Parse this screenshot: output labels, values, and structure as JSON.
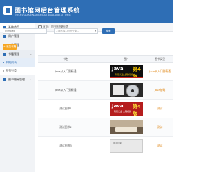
{
  "header": {
    "title": "图书馆网后台管理系统",
    "subtitle": "TUSHUGUANWANGHOUTAIGUANLIXITONG"
  },
  "sidebar": {
    "items": [
      {
        "label": "系统首页",
        "icon": "home-icon"
      },
      {
        "label": "用户管理",
        "icon": "users-icon"
      },
      {
        "label": "公告管理",
        "icon": "notice-icon"
      },
      {
        "label": "书籍管理",
        "icon": "book-icon"
      },
      {
        "label": "书籍列表",
        "icon": "list-icon"
      },
      {
        "label": "图书分类",
        "icon": "category-icon"
      },
      {
        "label": "图书借阅管理",
        "icon": "borrow-icon"
      }
    ]
  },
  "breadcrumb": {
    "home": "首页",
    "separator": "/",
    "current": "图书馆书籍列表"
  },
  "search": {
    "placeholder": "图书名称",
    "select_value": "--请选择--图书分类--",
    "select_caret": "▾",
    "button_label": "搜索"
  },
  "toolbar": {
    "add_label": "+ 添加书籍"
  },
  "table": {
    "columns": [
      "书名",
      "图片",
      "图书类型"
    ],
    "rows": [
      {
        "name": "Java从入门到精通",
        "type": "Java从入门到精通",
        "cover": "java"
      },
      {
        "name": "Java从入门到精通",
        "type": "Java基础",
        "cover": "cd"
      },
      {
        "name": "测试图书1",
        "type": "测试",
        "cover": "red"
      },
      {
        "name": "测试图书2",
        "type": "测试",
        "cover": "room"
      },
      {
        "name": "测试图书3",
        "type": "测试",
        "cover": "gray"
      }
    ]
  },
  "covers": {
    "java_text": "Java",
    "java_edition": "第4版",
    "java_sub": "附赠光盘 全程视频",
    "red_sub": "附赠光盘 全程视频",
    "gray_text": "图书封面"
  },
  "colors": {
    "brand": "#2e6eb5",
    "accent": "#f6a623",
    "type_text": "#e08a1c"
  }
}
